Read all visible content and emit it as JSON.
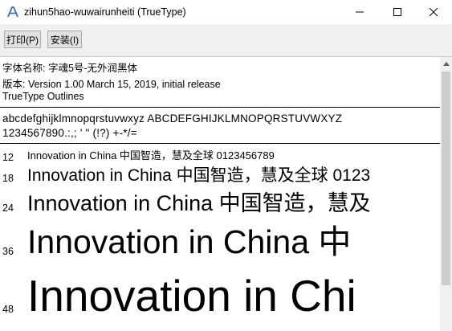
{
  "window": {
    "title": "zihun5hao-wuwairunheiti (TrueType)",
    "icon": "font-file-icon"
  },
  "toolbar": {
    "print_label": "打印(P)",
    "install_label": "安装(I)"
  },
  "font_info": {
    "name_line": "字体名称: 字魂5号-无外润黑体",
    "version_line": "版本: Version 1.00 March 15, 2019, initial release",
    "type_line": "TrueType Outlines"
  },
  "charset": {
    "line1": "abcdefghijklmnopqrstuvwxyz  ABCDEFGHIJKLMNOPQRSTUVWXYZ",
    "line2": "1234567890.:,; ' \" (!?) +-*/="
  },
  "samples": [
    {
      "size": "12",
      "text": "Innovation  in  China  中国智造，慧及全球  0123456789"
    },
    {
      "size": "18",
      "text": "Innovation  in  China  中国智造，慧及全球  0123"
    },
    {
      "size": "24",
      "text": "Innovation  in  China  中国智造，慧及"
    },
    {
      "size": "36",
      "text": "Innovation  in  China  中"
    },
    {
      "size": "48",
      "text": "Innovation  in  Chi"
    }
  ]
}
